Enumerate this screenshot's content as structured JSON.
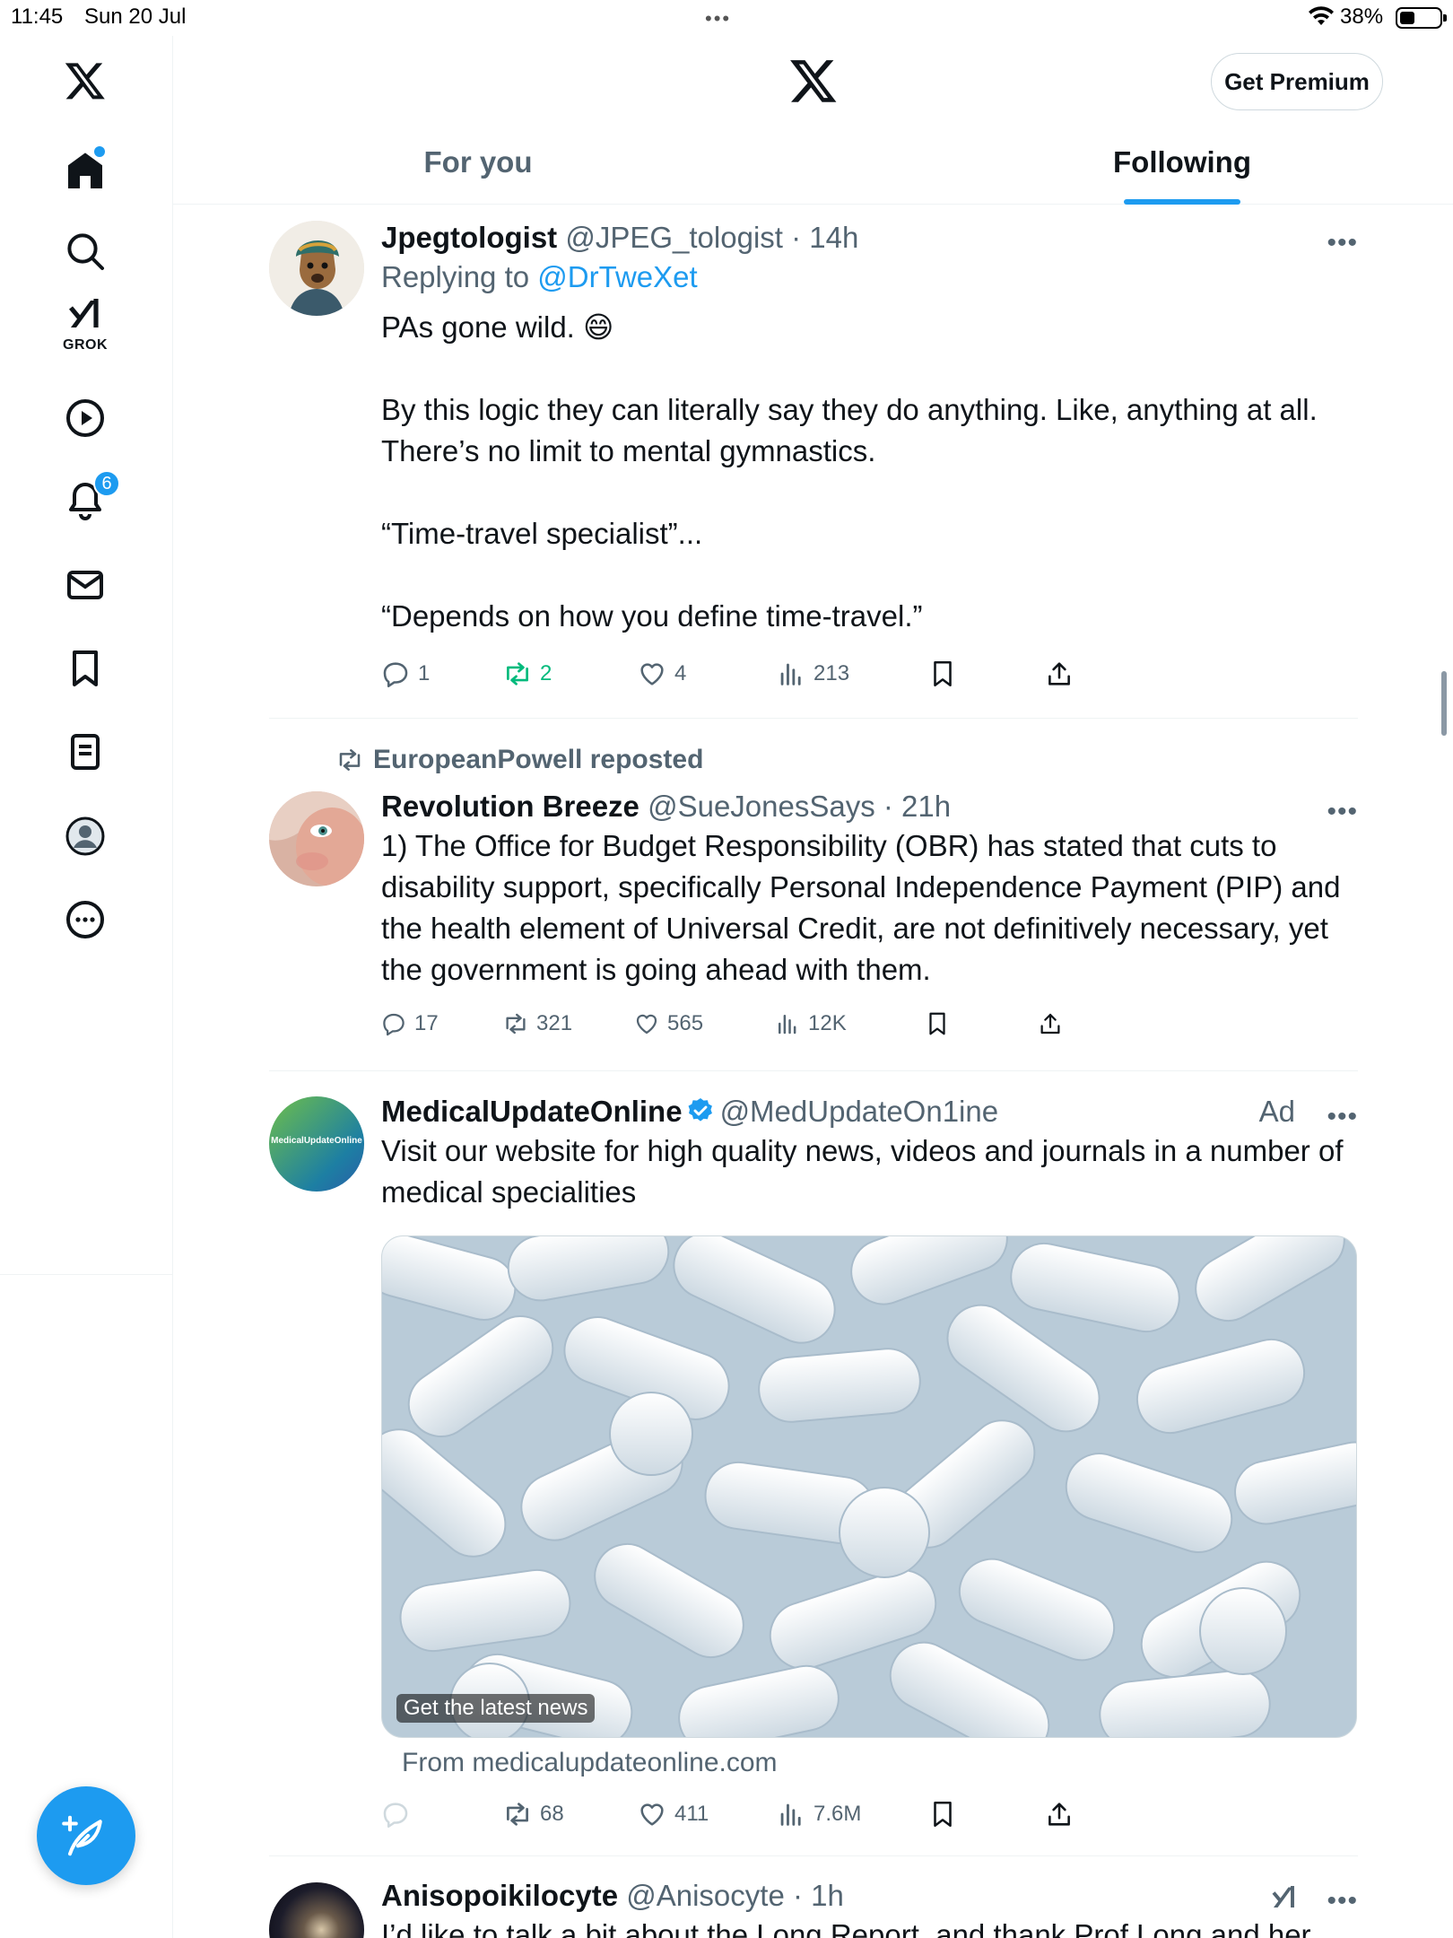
{
  "status_bar": {
    "time": "11:45",
    "date": "Sun 20 Jul",
    "battery": "38%",
    "battery_level": 0.38
  },
  "header": {
    "premium_label": "Get Premium",
    "tabs": [
      {
        "label": "For you"
      },
      {
        "label": "Following"
      }
    ]
  },
  "sidebar": {
    "notifications_badge": "6",
    "grok_label": "GROK"
  },
  "tweets": [
    {
      "name": "Jpegtologist",
      "handle": "@JPEG_tologist",
      "time": "· 14h",
      "reply_prefix": "Replying to",
      "reply_to": "@DrTweXet",
      "para1": "PAs gone wild. 😄",
      "para2": "By this logic they can literally say they do anything. Like, anything at all. There’s no limit to mental gymnastics.",
      "para3": "“Time-travel specialist”...",
      "para4": "“Depends on how you define time-travel.”",
      "replies": "1",
      "reposts": "2",
      "likes": "4",
      "views": "213"
    },
    {
      "repost_by": "EuropeanPowell reposted",
      "name": "Revolution Breeze",
      "handle": "@SueJonesSays",
      "time": "· 21h",
      "text": "1) The Office for Budget Responsibility (OBR) has stated that cuts to disability support, specifically Personal Independence Payment (PIP) and the health element of Universal Credit, are not definitively necessary, yet the government is going ahead with them.",
      "replies": "17",
      "reposts": "321",
      "likes": "565",
      "views": "12K"
    },
    {
      "name": "MedicalUpdateOnline",
      "handle": "@MedUpdateOn1ine",
      "ad": "Ad",
      "text": "Visit our website for high quality news, videos and journals in a number of medical specialities",
      "avatar_text": "MedicalUpdateOnline",
      "media_caption": "Get the latest news",
      "from": "From medicalupdateonline.com",
      "reposts": "68",
      "likes": "411",
      "views": "7.6M"
    },
    {
      "name": "Anisopoikilocyte",
      "handle": "@Anisocyte",
      "time": "· 1h",
      "text": "I’d like to talk a bit about the Long Report, and thank Prof Long and her"
    }
  ],
  "colors": {
    "accent": "#1d9bf0",
    "repost_green": "#00ba7c",
    "secondary_text": "#536471"
  }
}
